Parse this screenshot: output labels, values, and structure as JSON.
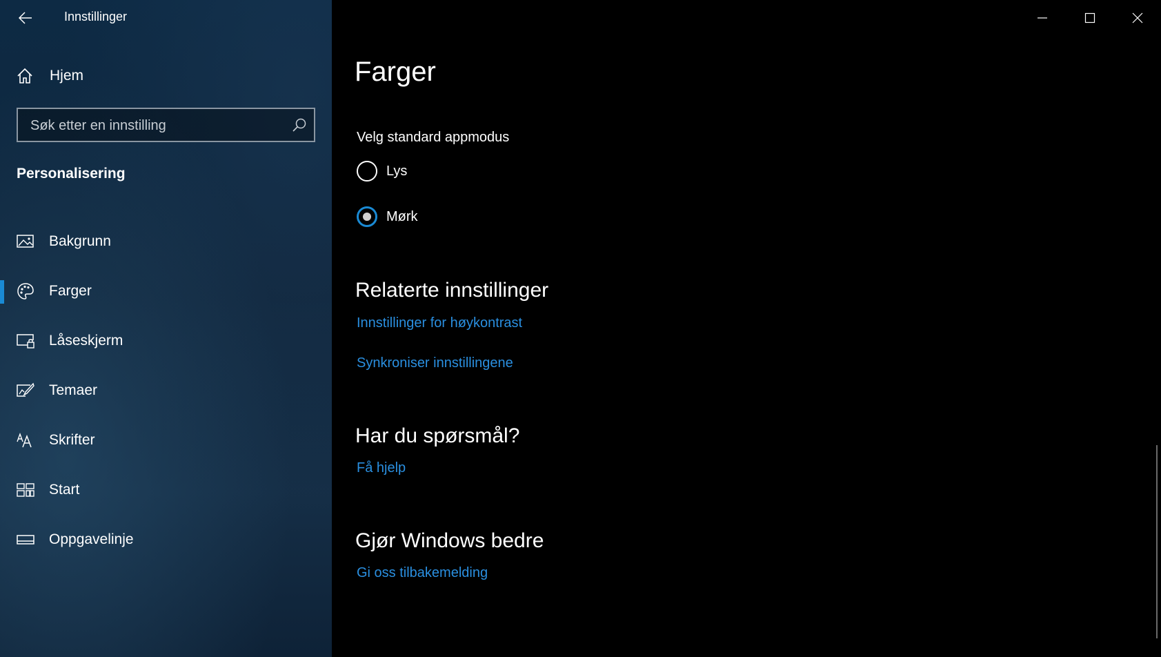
{
  "window": {
    "title": "Innstillinger",
    "controls": {
      "minimize_icon": "minimize-icon",
      "maximize_icon": "maximize-icon",
      "close_icon": "close-icon"
    }
  },
  "sidebar": {
    "home_label": "Hjem",
    "search_placeholder": "Søk etter en innstilling",
    "section_title": "Personalisering",
    "items": [
      {
        "label": "Bakgrunn",
        "icon": "picture-icon",
        "active": false
      },
      {
        "label": "Farger",
        "icon": "palette-icon",
        "active": true
      },
      {
        "label": "Låseskjerm",
        "icon": "lock-screen-icon",
        "active": false
      },
      {
        "label": "Temaer",
        "icon": "themes-icon",
        "active": false
      },
      {
        "label": "Skrifter",
        "icon": "fonts-icon",
        "active": false
      },
      {
        "label": "Start",
        "icon": "start-icon",
        "active": false
      },
      {
        "label": "Oppgavelinje",
        "icon": "taskbar-icon",
        "active": false
      }
    ]
  },
  "main": {
    "title": "Farger",
    "app_mode": {
      "label": "Velg standard appmodus",
      "options": [
        {
          "label": "Lys",
          "selected": false
        },
        {
          "label": "Mørk",
          "selected": true
        }
      ]
    },
    "related": {
      "heading": "Relaterte innstillinger",
      "links": [
        "Innstillinger for høykontrast",
        "Synkroniser innstillingene"
      ]
    },
    "questions": {
      "heading": "Har du spørsmål?",
      "link": "Få hjelp"
    },
    "feedback": {
      "heading": "Gjør Windows bedre",
      "link": "Gi oss tilbakemelding"
    }
  },
  "colors": {
    "accent": "#1a8ad4",
    "link": "#2a8fe0",
    "background": "#000000"
  }
}
